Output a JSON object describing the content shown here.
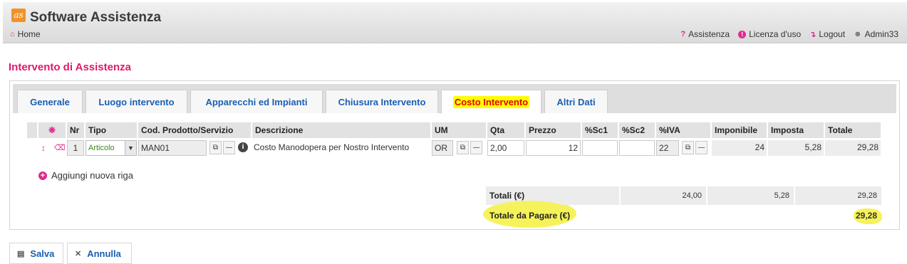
{
  "header": {
    "logo_text": "as",
    "app_title": "Software Assistenza",
    "home_label": "Home",
    "menu": [
      {
        "label": "Assistenza"
      },
      {
        "label": "Licenza d'uso"
      },
      {
        "label": "Logout"
      },
      {
        "label": "Admin33"
      }
    ]
  },
  "page_title": "Intervento di Assistenza",
  "tabs": [
    {
      "label": "Generale"
    },
    {
      "label": "Luogo intervento"
    },
    {
      "label": "Apparecchi ed Impianti"
    },
    {
      "label": "Chiusura Intervento"
    },
    {
      "label": "Costo Intervento",
      "active": true
    },
    {
      "label": "Altri Dati"
    }
  ],
  "grid": {
    "headers": {
      "nr": "Nr",
      "tipo": "Tipo",
      "codice": "Cod. Prodotto/Servizio",
      "descrizione": "Descrizione",
      "um": "UM",
      "qta": "Qta",
      "prezzo": "Prezzo",
      "sc1": "%Sc1",
      "sc2": "%Sc2",
      "iva": "%IVA",
      "imponibile": "Imponibile",
      "imposta": "Imposta",
      "totale": "Totale"
    },
    "rows": [
      {
        "nr": "1",
        "tipo": "Articolo",
        "codice": "MAN01",
        "descrizione": "Costo Manodopera per Nostro Intervento",
        "um": "OR",
        "qta": "2,00",
        "prezzo": "12",
        "sc1": "",
        "sc2": "",
        "iva": "22",
        "imponibile": "24",
        "imposta": "5,28",
        "totale": "29,28"
      }
    ]
  },
  "add_row_label": "Aggiungi nuova riga",
  "totals": {
    "label": "Totali (€)",
    "imponibile": "24,00",
    "imposta": "5,28",
    "totale": "29,28",
    "pay_label": "Totale da Pagare (€)",
    "pay_value": "29,28"
  },
  "buttons": {
    "save": "Salva",
    "cancel": "Annulla"
  },
  "colors": {
    "accent": "#e0186e",
    "link": "#1a5fb4",
    "highlight": "#f6f25a"
  }
}
